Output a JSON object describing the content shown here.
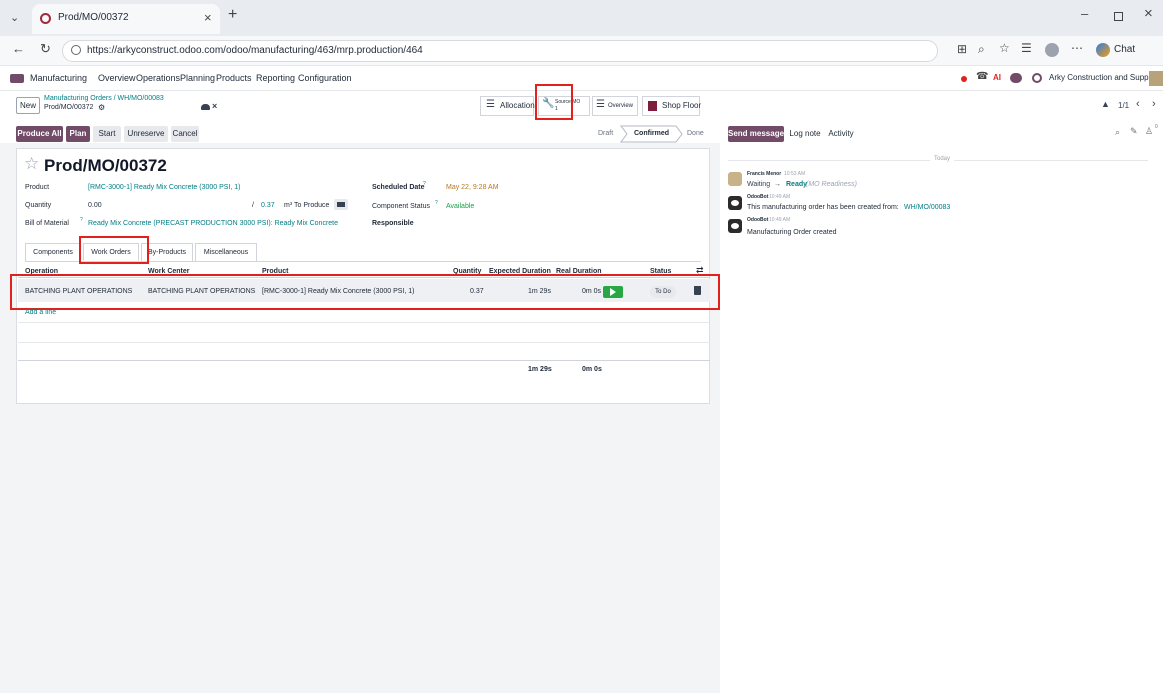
{
  "browser": {
    "tab_title": "Prod/MO/00372",
    "url": "https://arkyconstruct.odoo.com/odoo/manufacturing/463/mrp.production/464",
    "chat_label": "Chat"
  },
  "navbar": {
    "app": "Manufacturing",
    "menus": [
      "Overview",
      "Operations",
      "Planning",
      "Products",
      "Reporting",
      "Configuration"
    ],
    "company": "Arky Construction and Supply",
    "ai_badge": "AI"
  },
  "control_panel": {
    "new_label": "New",
    "breadcrumb_parent": "Manufacturing Orders / WH/MO/00083",
    "breadcrumb_current": "Prod/MO/00372",
    "smart_buttons": {
      "allocation": "Allocation",
      "source_mo": "Source MO",
      "source_mo_count": "1",
      "overview": "Overview",
      "shop_floor": "Shop Floor"
    },
    "pager": "1/1"
  },
  "actions": {
    "produce_all": "Produce All",
    "plan": "Plan",
    "start": "Start",
    "unreserve": "Unreserve",
    "cancel": "Cancel"
  },
  "statusbar": [
    "Draft",
    "Confirmed",
    "Done"
  ],
  "chatter_actions": {
    "send_message": "Send message",
    "log_note": "Log note",
    "activity": "Activity",
    "followers": "0"
  },
  "form": {
    "title": "Prod/MO/00372",
    "product_label": "Product",
    "product_value": "[RMC-3000-1] Ready Mix Concrete (3000 PSI, 1)",
    "quantity_label": "Quantity",
    "quantity_value": "0.00",
    "qty_sep": "/",
    "qty_to_produce": "0.37",
    "uom": "m³ To Produce",
    "bom_label": "Bill of Material",
    "bom_value": "Ready Mix Concrete (PRECAST PRODUCTION 3000 PSI): Ready Mix Concrete",
    "scheduled_label": "Scheduled Date",
    "scheduled_value": "May 22, 9:28 AM",
    "component_status_label": "Component Status",
    "component_status_value": "Available",
    "responsible_label": "Responsible",
    "help_mark": "?"
  },
  "tabs": [
    "Components",
    "Work Orders",
    "By-Products",
    "Miscellaneous"
  ],
  "table": {
    "headers": [
      "Operation",
      "Work Center",
      "Product",
      "Quantity",
      "Expected Duration",
      "Real Duration",
      "Status"
    ],
    "rows": [
      {
        "operation": "BATCHING PLANT OPERATIONS",
        "work_center": "BATCHING PLANT OPERATIONS",
        "product": "[RMC-3000-1] Ready Mix Concrete (3000 PSI, 1)",
        "quantity": "0.37",
        "expected": "1m 29s",
        "real": "0m 0s",
        "status": "To Do"
      }
    ],
    "add_line": "Add a line",
    "total_expected": "1m 29s",
    "total_real": "0m 0s"
  },
  "chatter": {
    "day": "Today",
    "messages": [
      {
        "author": "Francis Menor",
        "time": "10:53 AM",
        "from": "Waiting",
        "arrow": "→",
        "to": "Ready",
        "field": "(MO Readiness)"
      },
      {
        "author": "OdooBot",
        "time": "10:49 AM",
        "body": "This manufacturing order has been created from:",
        "link": "WH/MO/00083"
      },
      {
        "author": "OdooBot",
        "time": "10:49 AM",
        "body": "Manufacturing Order created"
      }
    ]
  },
  "colors": {
    "primary": "#714b67",
    "link": "#017e84",
    "highlight": "#e0211d",
    "scheduled": "#b7791f"
  }
}
